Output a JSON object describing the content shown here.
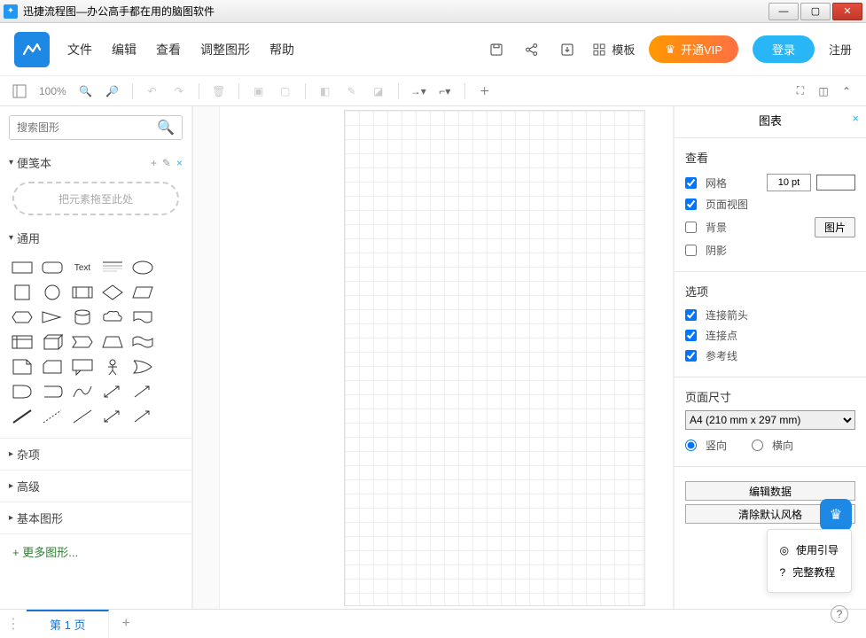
{
  "app": {
    "title": "迅捷流程图—办公高手都在用的脑图软件"
  },
  "menu": {
    "file": "文件",
    "edit": "编辑",
    "view": "查看",
    "adjust": "调整图形",
    "help": "帮助"
  },
  "topbar": {
    "template": "模板",
    "vip": "开通VIP",
    "login": "登录",
    "register": "注册"
  },
  "toolbar": {
    "zoom": "100%"
  },
  "search": {
    "placeholder": "搜索图形"
  },
  "sections": {
    "scratchpad": {
      "title": "便笺本",
      "dropzone": "把元素拖至此处"
    },
    "general": {
      "title": "通用",
      "text_label": "Text"
    },
    "misc": "杂项",
    "advanced": "高级",
    "basic": "基本图形",
    "more": "更多图形..."
  },
  "rightpanel": {
    "title": "图表",
    "view": {
      "heading": "查看",
      "grid": "网格",
      "grid_size": "10 pt",
      "page_view": "页面视图",
      "background": "背景",
      "bg_btn": "图片",
      "shadow": "阴影"
    },
    "options": {
      "heading": "选项",
      "arrows": "连接箭头",
      "points": "连接点",
      "guides": "参考线"
    },
    "page_size": {
      "heading": "页面尺寸",
      "value": "A4 (210 mm x 297 mm)",
      "portrait": "竖向",
      "landscape": "横向"
    },
    "edit_data": "编辑数据",
    "clear_style": "清除默认风格"
  },
  "help": {
    "guide": "使用引导",
    "tutorial": "完整教程"
  },
  "pages": {
    "tab1": "第 1 页"
  }
}
